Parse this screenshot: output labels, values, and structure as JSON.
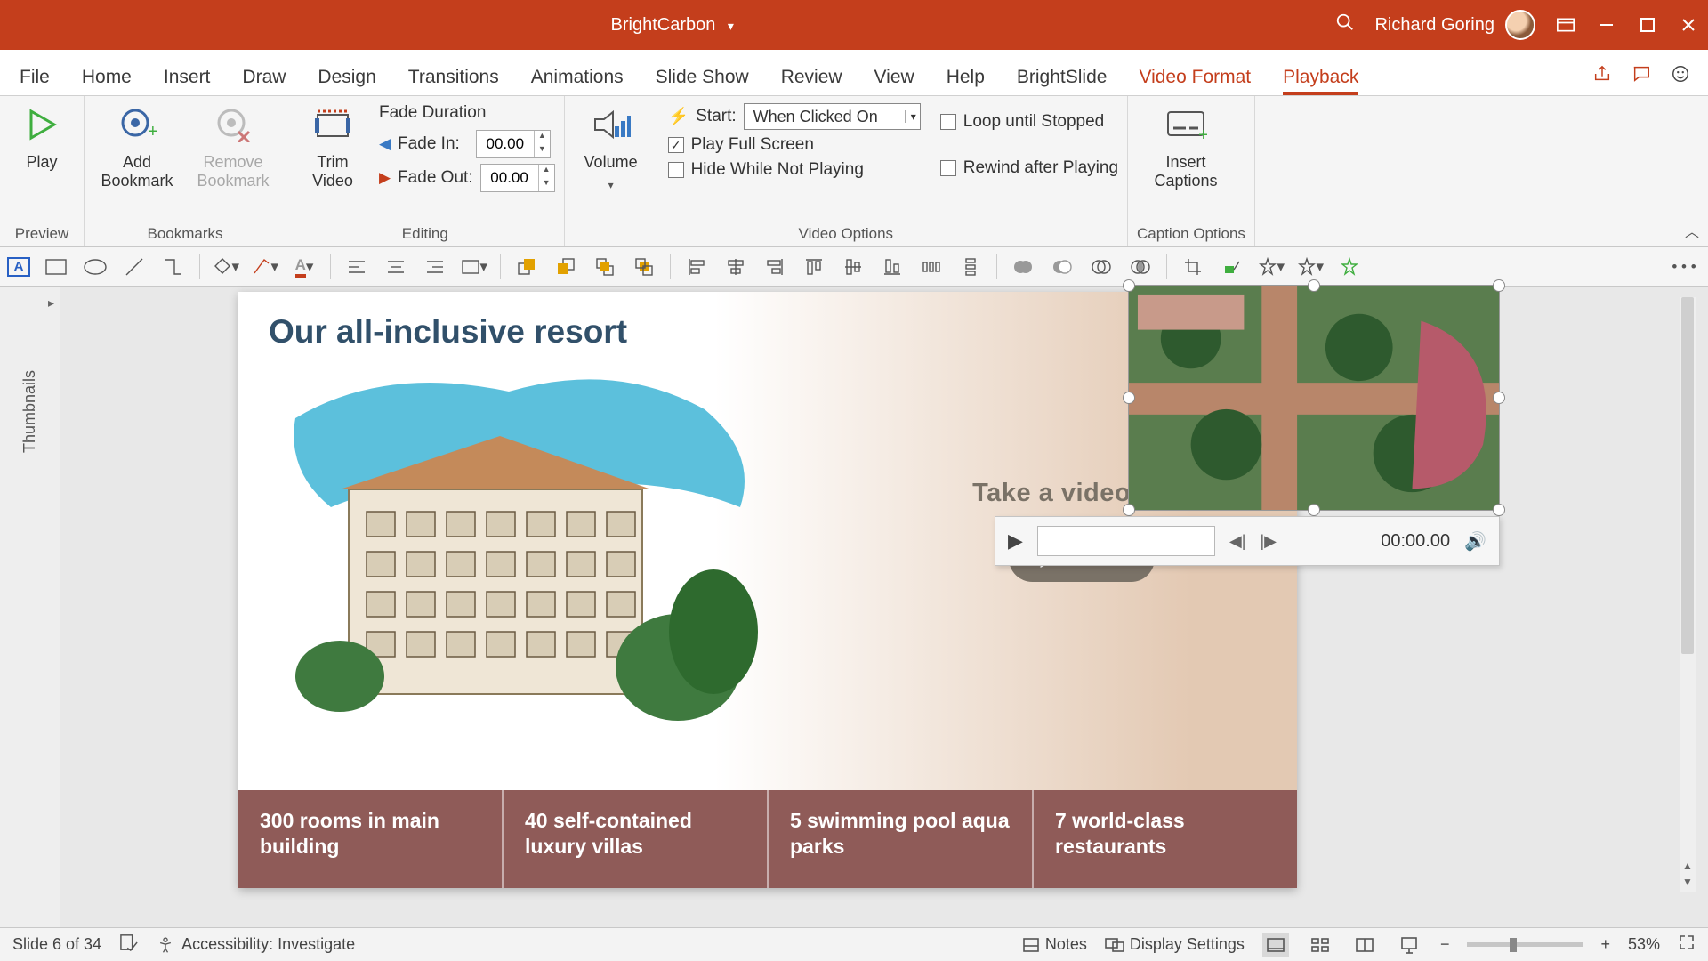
{
  "title_bar": {
    "document_name": "BrightCarbon",
    "user_name": "Richard Goring"
  },
  "tabs": {
    "items": [
      "File",
      "Home",
      "Insert",
      "Draw",
      "Design",
      "Transitions",
      "Animations",
      "Slide Show",
      "Review",
      "View",
      "Help",
      "BrightSlide",
      "Video Format",
      "Playback"
    ],
    "context_start_index": 12,
    "active": "Playback"
  },
  "ribbon": {
    "preview": {
      "label": "Preview",
      "play": "Play"
    },
    "bookmarks": {
      "label": "Bookmarks",
      "add": "Add\nBookmark",
      "remove": "Remove\nBookmark"
    },
    "editing": {
      "label": "Editing",
      "trim": "Trim\nVideo",
      "fade_duration": "Fade Duration",
      "fade_in_label": "Fade In:",
      "fade_in_value": "00.00",
      "fade_out_label": "Fade Out:",
      "fade_out_value": "00.00"
    },
    "video_options": {
      "label": "Video Options",
      "volume": "Volume",
      "start_label": "Start:",
      "start_value": "When Clicked On",
      "play_full_screen": "Play Full Screen",
      "hide_while_not_playing": "Hide While Not Playing",
      "loop_until_stopped": "Loop until Stopped",
      "rewind_after_playing": "Rewind after Playing"
    },
    "caption_options": {
      "label": "Caption Options",
      "insert_captions": "Insert\nCaptions"
    }
  },
  "slide": {
    "title": "Our all-inclusive resort",
    "tour_heading": "Take a video tour",
    "play_label": "PLAY",
    "facts": [
      "300 rooms in main building",
      "40 self-contained luxury villas",
      "5 swimming pool aqua parks",
      "7 world-class restaurants"
    ]
  },
  "video_controls": {
    "time": "00:00.00"
  },
  "status_bar": {
    "slide_indicator": "Slide 6 of 34",
    "accessibility": "Accessibility: Investigate",
    "notes": "Notes",
    "display_settings": "Display Settings",
    "zoom_pct": "53%"
  },
  "thumbnails_label": "Thumbnails"
}
